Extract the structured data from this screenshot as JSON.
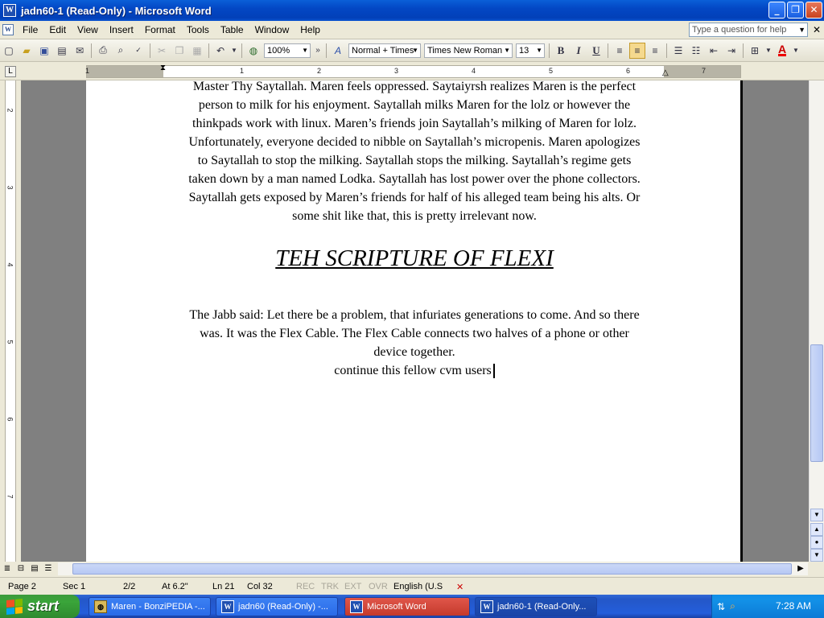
{
  "window": {
    "title": "jadn60-1 (Read-Only) - Microsoft Word",
    "controls": [
      "_",
      "❐",
      "✕"
    ]
  },
  "menu": {
    "items": [
      "File",
      "Edit",
      "View",
      "Insert",
      "Format",
      "Tools",
      "Table",
      "Window",
      "Help"
    ],
    "help_placeholder": "Type a question for help"
  },
  "toolbar": {
    "zoom": "100%",
    "style": "Normal + Times",
    "font": "Times New Roman",
    "size": "13",
    "bold_label": "B",
    "italic_label": "I",
    "underline_label": "U",
    "font_color_label": "A"
  },
  "ruler": {
    "numbers": [
      "1",
      "1",
      "2",
      "3",
      "4",
      "5",
      "6",
      "7"
    ],
    "vnumbers": [
      "2",
      "3",
      "4",
      "5",
      "6",
      "7"
    ]
  },
  "document": {
    "para1_lines": [
      "Master Thy Saytallah. Maren feels oppressed. Saytaiyrsh realizes Maren is the perfect",
      "person to milk for his enjoyment. Saytallah milks Maren for the lolz or however the",
      "thinkpads work with linux. Maren’s friends join Saytallah’s milking of Maren for lolz.",
      "Unfortunately, everyone decided to nibble on Saytallah’s micropenis. Maren apologizes",
      "to Saytallah to stop the milking. Saytallah stops the milking. Saytallah’s regime gets",
      "taken down by a man named Lodka. Saytallah has lost power over the phone collectors.",
      "Saytallah gets exposed by Maren’s friends for half of his alleged team being his alts. Or",
      "some shit like that, this is pretty irrelevant now."
    ],
    "heading": "TEH SCRIPTURE OF FLEXI",
    "para2_lines": [
      "The Jabb said: Let there be a problem, that infuriates generations to come. And so there",
      "was. It was the Flex Cable. The Flex Cable connects two halves of a phone or other",
      "device together."
    ],
    "para3": "continue this fellow cvm users"
  },
  "status": {
    "page": "Page  2",
    "sec": "Sec  1",
    "pages": "2/2",
    "at": "At  6.2\"",
    "ln": "Ln  21",
    "col": "Col  32",
    "rec": "REC",
    "trk": "TRK",
    "ext": "EXT",
    "ovr": "OVR",
    "language": "English (U.S"
  },
  "taskbar": {
    "start_label": "start",
    "tasks": [
      "Maren - BonziPEDIA -...",
      "jadn60 (Read-Only) -...",
      "Microsoft Word",
      "jadn60-1 (Read-Only..."
    ],
    "clock": "7:28 AM"
  },
  "colors": {
    "title_bar": "#0347c4",
    "taskbar": "#245edb",
    "start_button": "#3aa53a",
    "document_bg": "#ffffff",
    "workspace_bg": "#808080"
  }
}
